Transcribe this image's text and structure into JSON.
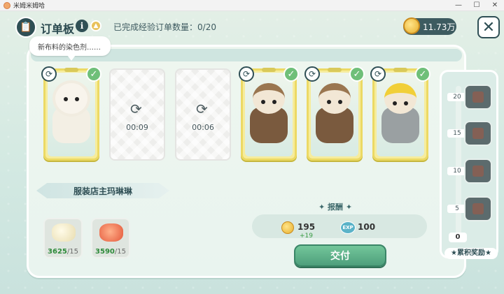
{
  "window": {
    "title": "米姆米姆哈",
    "controls": [
      "—",
      "☐",
      "✕"
    ]
  },
  "header": {
    "title": "订单板",
    "info_icon": "i",
    "upgrade_icon": "▲",
    "progress_label": "已完成经验订单数量：",
    "progress_value": "0/20",
    "currency": "11.73万",
    "close_glyph": "✕"
  },
  "tooltip": "新布料的染色剂……",
  "orders": [
    {
      "state": "done",
      "character": "sheep"
    },
    {
      "state": "waiting",
      "timer": "00:09"
    },
    {
      "state": "waiting",
      "timer": "00:06"
    },
    {
      "state": "done",
      "character": "aviator"
    },
    {
      "state": "done",
      "character": "aviator"
    },
    {
      "state": "done",
      "character": "knight"
    }
  ],
  "npc_name": "服装店主玛琳琳",
  "materials": [
    {
      "have": "3625",
      "need": "/15",
      "icon": "cotton"
    },
    {
      "have": "3590",
      "need": "/15",
      "icon": "red-flower"
    }
  ],
  "reward": {
    "title": "报酬",
    "coin_value": "195",
    "coin_bonus": "+19",
    "exp_badge": "EXP",
    "exp_value": "100"
  },
  "deliver_label": "交付",
  "accumulate": {
    "levels": [
      "20",
      "15",
      "10",
      "5"
    ],
    "current": "0",
    "label": "★累积奖励★"
  }
}
